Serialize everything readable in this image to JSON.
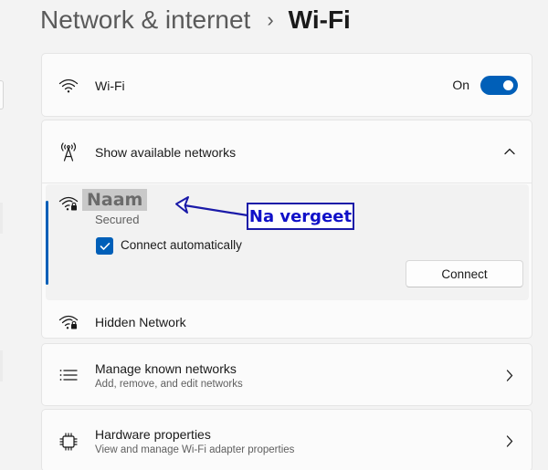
{
  "header": {
    "breadcrumb_parent": "Network & internet",
    "separator": "›",
    "current_page": "Wi-Fi"
  },
  "wifi_card": {
    "label": "Wi-Fi",
    "state_text": "On",
    "enabled": true
  },
  "networks_card": {
    "header_label": "Show available networks",
    "expanded": true,
    "selected_network": {
      "name": "Naam",
      "security": "Secured",
      "connect_automatically_label": "Connect automatically",
      "connect_automatically_checked": true,
      "connect_button_label": "Connect"
    },
    "hidden_network_label": "Hidden Network"
  },
  "manage_card": {
    "title": "Manage known networks",
    "description": "Add, remove, and edit networks"
  },
  "hardware_card": {
    "title": "Hardware properties",
    "description": "View and manage Wi-Fi adapter properties"
  },
  "annotation": {
    "text": "Na vergeet",
    "color": "#1010c8"
  },
  "colors": {
    "accent": "#005fb8",
    "background": "#f3f3f3",
    "card": "#fbfbfb"
  },
  "icons": {
    "wifi": "wifi-icon",
    "antenna": "antenna-icon",
    "secured_wifi": "wifi-lock-icon",
    "list": "list-icon",
    "chip": "chip-icon",
    "chevron_up": "chevron-up-icon",
    "chevron_right": "chevron-right-icon"
  }
}
